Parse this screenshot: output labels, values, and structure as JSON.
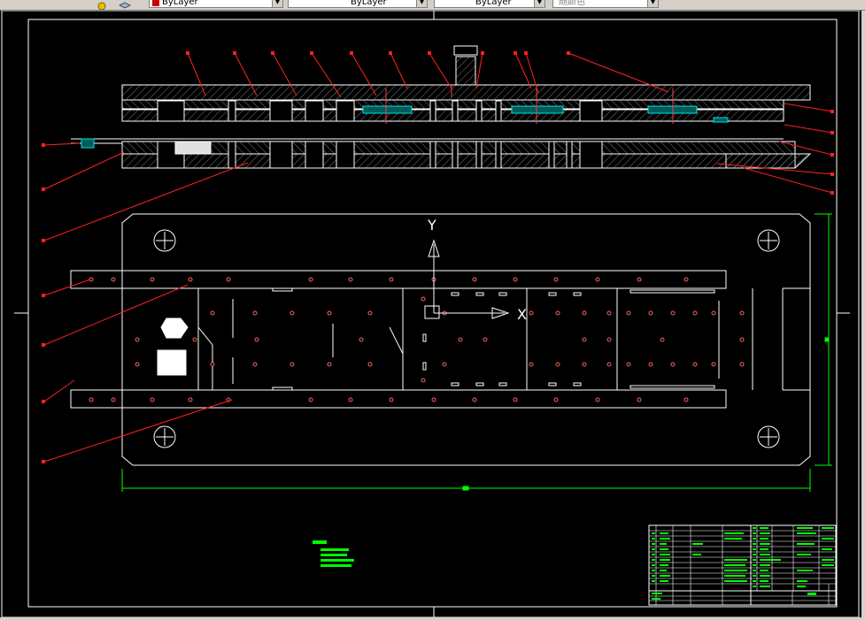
{
  "toolbar": {
    "color_combo": {
      "value": "ByLayer",
      "swatch": "#cc0000"
    },
    "linetype_combo": {
      "value": "ByLayer"
    },
    "lineweight_combo": {
      "value": "ByLayer"
    },
    "plotstyle_combo": {
      "value": "随颜色"
    },
    "dropdown_arrow": "▼"
  },
  "drawing": {
    "ucs": {
      "y_label": "Y",
      "x_label": "X"
    },
    "colors": {
      "outline": "#ffffff",
      "leader": "#ff2020",
      "dimension": "#00ff00",
      "hatch": "#7a7a7a",
      "insert": "#00e5e5",
      "table_text": "#00ff00",
      "background": "#000000"
    }
  }
}
